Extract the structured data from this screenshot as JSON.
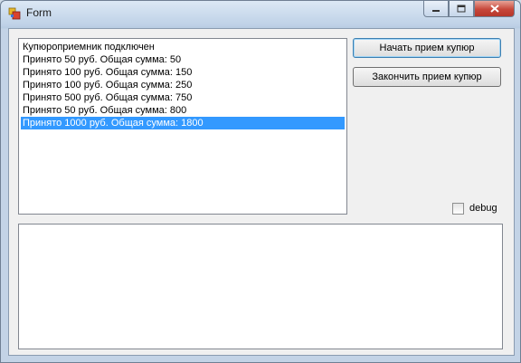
{
  "window": {
    "title": "Form",
    "icon": "form-app-icon",
    "minimize_icon": "minimize-icon",
    "maximize_icon": "maximize-icon",
    "close_icon": "close-icon"
  },
  "listbox": {
    "items": [
      "Купюроприемник подключен",
      "Принято 50 руб. Общая сумма: 50",
      "Принято 100 руб. Общая сумма: 150",
      "Принято 100 руб. Общая сумма: 250",
      "Принято 500 руб. Общая сумма: 750",
      "Принято 50 руб. Общая сумма: 800",
      "Принято 1000 руб. Общая сумма: 1800"
    ],
    "selected_index": 6
  },
  "buttons": {
    "start_label": "Начать прием купюр",
    "stop_label": "Закончить прием купюр"
  },
  "debug": {
    "label": "debug",
    "checked": false
  },
  "log_text": ""
}
